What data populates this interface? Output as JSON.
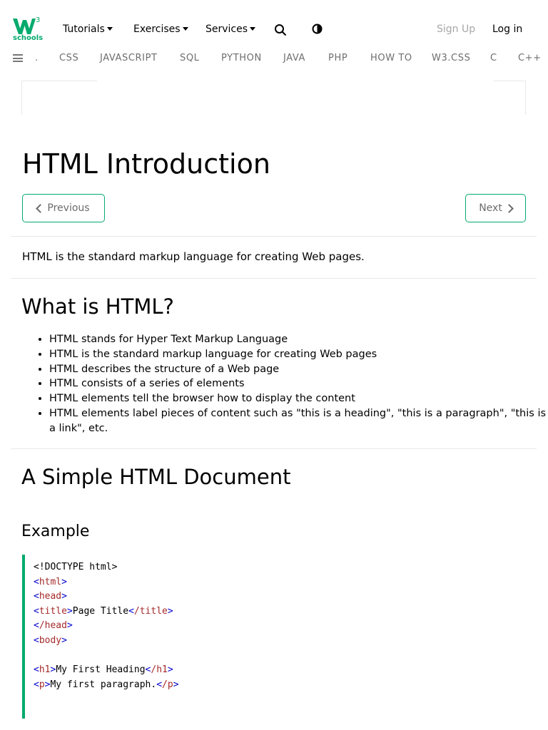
{
  "header": {
    "logo_text": "schools",
    "logo_sup": "3",
    "menus": [
      {
        "label": "Tutorials"
      },
      {
        "label": "Exercises"
      },
      {
        "label": "Services"
      }
    ],
    "signup_label": "Sign Up",
    "login_label": "Log in",
    "icons": [
      "search-icon",
      "contrast-icon",
      "menu-icon"
    ],
    "brand_color": "#04AA6D"
  },
  "subnav": {
    "items": [
      ".",
      "CSS",
      "JAVASCRIPT",
      "SQL",
      "PYTHON",
      "JAVA",
      "PHP",
      "HOW TO",
      "W3.CSS",
      "C",
      "C++"
    ]
  },
  "main": {
    "title": "HTML Introduction",
    "prev_label": "Previous",
    "next_label": "Next",
    "intro": "HTML is the standard markup language for creating Web pages.",
    "section1_title": "What is HTML?",
    "bullets": [
      "HTML stands for Hyper Text Markup Language",
      "HTML is the standard markup language for creating Web pages",
      "HTML describes the structure of a Web page",
      "HTML consists of a series of elements",
      "HTML elements tell the browser how to display the content",
      "HTML elements label pieces of content such as \"this is a heading\", \"this is a paragraph\", \"this is a link\", etc."
    ],
    "section2_title": "A Simple HTML Document",
    "example_title": "Example",
    "code_lines": [
      "<!DOCTYPE html>",
      "<html>",
      "<head>",
      "<title>Page Title</title>",
      "</head>",
      "<body>",
      "",
      "<h1>My First Heading</h1>",
      "<p>My first paragraph.</p>"
    ]
  }
}
